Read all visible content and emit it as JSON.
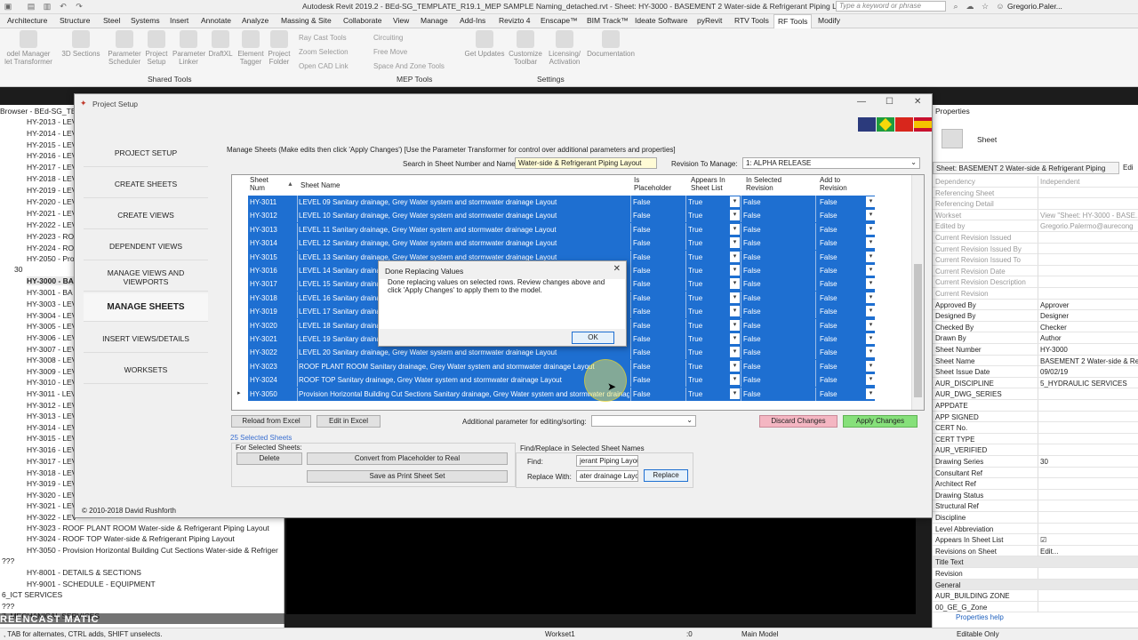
{
  "titlebar": {
    "title": "Autodesk Revit 2019.2 - BEd-SG_TEMPLATE_R19.1_MEP SAMPLE Naming_detached.rvt - Sheet: HY-3000 - BASEMENT 2 Water-side & Refrigerant Piping Layout",
    "search_placeholder": "Type a keyword or phrase",
    "user": "Gregorio.Paler..."
  },
  "ribbon_tabs": [
    "Architecture",
    "Structure",
    "Steel",
    "Systems",
    "Insert",
    "Annotate",
    "Analyze",
    "Massing & Site",
    "Collaborate",
    "View",
    "Manage",
    "Add-Ins",
    "Revizto 4",
    "Enscape™",
    "BIM Track™",
    "Ideate Software",
    "pyRevit",
    "RTV Tools",
    "RF Tools",
    "Modify"
  ],
  "ribbon": {
    "buttons": [
      "odel Manager\nlet Transformer",
      "3D Sections",
      "Parameter\nScheduler",
      "Project\nSetup",
      "Parameter\nLinker",
      "DraftXL",
      "Element\nTagger",
      "Project\nFolder",
      "Get Updates",
      "Customize\nToolbar",
      "Licensing/\nActivation",
      "Documentation"
    ],
    "small": [
      "Ray Cast Tools",
      "Zoom Selection",
      "Open CAD Link",
      "Circuiting",
      "Free Move",
      "Space And Zone Tools"
    ],
    "groups": [
      "Shared Tools",
      "MEP Tools",
      "Settings"
    ]
  },
  "browser": {
    "header": "Browser - BEd-SG_TEM",
    "items": [
      "HY-2013 - LEV",
      "HY-2014 - LEV",
      "HY-2015 - LEV",
      "HY-2016 - LEV",
      "HY-2017 - LEV",
      "HY-2018 - LEV",
      "HY-2019 - LEV",
      "HY-2020 - LEV",
      "HY-2021 - LEV",
      "HY-2022 - LEV",
      "HY-2023 - RO",
      "HY-2024 - RO",
      "HY-2050 - Pro",
      "30",
      "HY-3000 - BA",
      "HY-3001 - BA",
      "HY-3003 - LEV",
      "HY-3004 - LEV",
      "HY-3005 - LEV",
      "HY-3006 - LEV",
      "HY-3007 - LEV",
      "HY-3008 - LEV",
      "HY-3009 - LEV",
      "HY-3010 - LEV",
      "HY-3011 - LEV",
      "HY-3012 - LEV",
      "HY-3013 - LEV",
      "HY-3014 - LEV",
      "HY-3015 - LEV",
      "HY-3016 - LEV",
      "HY-3017 - LEV",
      "HY-3018 - LEV",
      "HY-3019 - LEV",
      "HY-3020 - LEV",
      "HY-3021 - LEV",
      "HY-3022 - LEV",
      "HY-3023 - ROOF PLANT ROOM Water-side & Refrigerant Piping Layout",
      "HY-3024 - ROOF TOP Water-side & Refrigerant Piping Layout",
      "HY-3050 - Provision Horizontal Building Cut Sections Water-side & Refriger",
      "???",
      "HY-8001 - DETAILS & SECTIONS",
      "HY-9001 - SCHEDULE - EQUIPMENT",
      "6_ICT SERVICES",
      "???",
      "7_MECHANICAL SERVICES"
    ]
  },
  "watermark": "REENCAST MATIC",
  "status_hint": ", TAB for alternates, CTRL adds, SHIFT unselects.",
  "status": {
    "workset": "Workset1",
    "zero": ":0",
    "model": "Main Model",
    "editable": "Editable Only"
  },
  "properties": {
    "header": "Properties",
    "type": "Sheet",
    "selector": "Sheet: BASEMENT 2 Water-side & Refrigerant Piping",
    "edit": "Edi",
    "rows": [
      {
        "k": "Dependency",
        "v": "Independent",
        "dim": true
      },
      {
        "k": "Referencing Sheet",
        "v": "",
        "dim": true
      },
      {
        "k": "Referencing Detail",
        "v": "",
        "dim": true
      },
      {
        "k": "Workset",
        "v": "View \"Sheet: HY-3000 - BASE...",
        "dim": true
      },
      {
        "k": "Edited by",
        "v": "Gregorio.Palermo@aurecong",
        "dim": true
      },
      {
        "k": "Current Revision Issued",
        "v": "",
        "dim": true
      },
      {
        "k": "Current Revision Issued By",
        "v": "",
        "dim": true
      },
      {
        "k": "Current Revision Issued To",
        "v": "",
        "dim": true
      },
      {
        "k": "Current Revision Date",
        "v": "",
        "dim": true
      },
      {
        "k": "Current Revision Description",
        "v": "",
        "dim": true
      },
      {
        "k": "Current Revision",
        "v": "",
        "dim": true
      },
      {
        "k": "Approved By",
        "v": "Approver",
        "dim": false
      },
      {
        "k": "Designed By",
        "v": "Designer",
        "dim": false
      },
      {
        "k": "Checked By",
        "v": "Checker",
        "dim": false
      },
      {
        "k": "Drawn By",
        "v": "Author",
        "dim": false
      },
      {
        "k": "Sheet Number",
        "v": "HY-3000",
        "dim": false
      },
      {
        "k": "Sheet Name",
        "v": "BASEMENT 2 Water-side & Re",
        "dim": false
      },
      {
        "k": "Sheet Issue Date",
        "v": "09/02/19",
        "dim": false
      },
      {
        "k": "AUR_DISCIPLINE",
        "v": "5_HYDRAULIC SERVICES",
        "dim": false
      },
      {
        "k": "AUR_DWG_SERIES",
        "v": "",
        "dim": false
      },
      {
        "k": "APPDATE",
        "v": "",
        "dim": false
      },
      {
        "k": "APP SIGNED",
        "v": "",
        "dim": false
      },
      {
        "k": "CERT No.",
        "v": "",
        "dim": false
      },
      {
        "k": "CERT TYPE",
        "v": "",
        "dim": false
      },
      {
        "k": "AUR_VERIFIED",
        "v": "",
        "dim": false
      },
      {
        "k": "Drawing Series",
        "v": "30",
        "dim": false
      },
      {
        "k": "Consultant Ref",
        "v": "",
        "dim": false
      },
      {
        "k": "Architect Ref",
        "v": "",
        "dim": false
      },
      {
        "k": "Drawing Status",
        "v": "",
        "dim": false
      },
      {
        "k": "Structural Ref",
        "v": "",
        "dim": false
      },
      {
        "k": "Discipline",
        "v": "",
        "dim": false
      },
      {
        "k": "Level Abbreviation",
        "v": "",
        "dim": false
      },
      {
        "k": "Appears In Sheet List",
        "v": "☑",
        "dim": false
      },
      {
        "k": "Revisions on Sheet",
        "v": "Edit...",
        "dim": false
      },
      {
        "k": "Title Text",
        "v": "",
        "dim": false,
        "section": true
      },
      {
        "k": "Revision",
        "v": "",
        "dim": false
      },
      {
        "k": "General",
        "v": "",
        "dim": false,
        "section": true
      },
      {
        "k": "AUR_BUILDING ZONE",
        "v": "",
        "dim": false
      },
      {
        "k": "00_GE_G_Zone",
        "v": "",
        "dim": false
      }
    ],
    "help": "Properties help"
  },
  "dialog": {
    "title": "Project Setup",
    "nav": [
      "PROJECT SETUP",
      "CREATE SHEETS",
      "CREATE VIEWS",
      "DEPENDENT VIEWS",
      "MANAGE VIEWS AND\nVIEWPORTS",
      "MANAGE SHEETS",
      "INSERT VIEWS/DETAILS",
      "WORKSETS"
    ],
    "copyright": "© 2010-2018 David Rushforth",
    "instructions": "Manage Sheets (Make edits then click 'Apply Changes') [Use the Parameter Transformer for control over additional parameters and properties]",
    "search_label": "Search in Sheet Number and Name:",
    "search_value": "Water-side & Refrigerant Piping Layout",
    "revision_label": "Revision To Manage:",
    "revision_value": "1: ALPHA RELEASE",
    "headers": [
      "Sheet\nNum",
      "Sheet Name",
      "Is\nPlaceholder",
      "Appears In\nSheet List",
      "In Selected\nRevision",
      "Add to\nRevision"
    ],
    "rows": [
      {
        "num": "HY-3011",
        "name": "LEVEL 09 Sanitary drainage, Grey Water system and stormwater drainage Layout",
        "ph": "False",
        "asl": "True",
        "isr": "False",
        "atr": "False"
      },
      {
        "num": "HY-3012",
        "name": "LEVEL 10 Sanitary drainage, Grey Water system and stormwater drainage Layout",
        "ph": "False",
        "asl": "True",
        "isr": "False",
        "atr": "False"
      },
      {
        "num": "HY-3013",
        "name": "LEVEL 11 Sanitary drainage, Grey Water system and stormwater drainage Layout",
        "ph": "False",
        "asl": "True",
        "isr": "False",
        "atr": "False"
      },
      {
        "num": "HY-3014",
        "name": "LEVEL 12 Sanitary drainage, Grey Water system and stormwater drainage Layout",
        "ph": "False",
        "asl": "True",
        "isr": "False",
        "atr": "False"
      },
      {
        "num": "HY-3015",
        "name": "LEVEL 13 Sanitary drainage, Grey Water system and stormwater drainage Layout",
        "ph": "False",
        "asl": "True",
        "isr": "False",
        "atr": "False"
      },
      {
        "num": "HY-3016",
        "name": "LEVEL 14 Sanitary drainage",
        "ph": "False",
        "asl": "True",
        "isr": "False",
        "atr": "False"
      },
      {
        "num": "HY-3017",
        "name": "LEVEL 15 Sanitary drainage",
        "ph": "False",
        "asl": "True",
        "isr": "False",
        "atr": "False"
      },
      {
        "num": "HY-3018",
        "name": "LEVEL 16 Sanitary drainage",
        "ph": "False",
        "asl": "True",
        "isr": "False",
        "atr": "False"
      },
      {
        "num": "HY-3019",
        "name": "LEVEL 17 Sanitary drainage",
        "ph": "False",
        "asl": "True",
        "isr": "False",
        "atr": "False"
      },
      {
        "num": "HY-3020",
        "name": "LEVEL 18 Sanitary drainage",
        "ph": "False",
        "asl": "True",
        "isr": "False",
        "atr": "False"
      },
      {
        "num": "HY-3021",
        "name": "LEVEL 19 Sanitary drainage",
        "ph": "False",
        "asl": "True",
        "isr": "False",
        "atr": "False"
      },
      {
        "num": "HY-3022",
        "name": "LEVEL 20 Sanitary drainage, Grey Water system and stormwater drainage Layout",
        "ph": "False",
        "asl": "True",
        "isr": "False",
        "atr": "False"
      },
      {
        "num": "HY-3023",
        "name": "ROOF PLANT ROOM Sanitary drainage, Grey Water system and stormwater drainage Layout",
        "ph": "False",
        "asl": "True",
        "isr": "False",
        "atr": "False"
      },
      {
        "num": "HY-3024",
        "name": "ROOF TOP Sanitary drainage, Grey Water system and stormwater drainage Layout",
        "ph": "False",
        "asl": "True",
        "isr": "False",
        "atr": "False"
      },
      {
        "num": "HY-3050",
        "name": "Provision Horizontal Building Cut Sections Sanitary drainage, Grey Water system and stormwater drainage Layout",
        "ph": "False",
        "asl": "True",
        "isr": "False",
        "atr": "False"
      }
    ],
    "reload": "Reload from Excel",
    "edit_excel": "Edit in Excel",
    "additional_param": "Additional parameter for editing/sorting:",
    "discard": "Discard Changes",
    "apply": "Apply Changes",
    "selected_count": "25 Selected Sheets",
    "for_selected": "For Selected Sheets:",
    "delete": "Delete",
    "convert": "Convert from Placeholder to Real",
    "save_print": "Save as Print Sheet Set",
    "find_replace_label": "Find/Replace in Selected Sheet Names",
    "find_label": "Find:",
    "find_value": "jerant Piping Layout",
    "replace_label": "Replace With:",
    "replace_value": "ater drainage Layout",
    "replace_btn": "Replace"
  },
  "message": {
    "title": "Done Replacing Values",
    "text": "Done replacing values on selected rows.  Review changes above and click 'Apply Changes' to apply them to the model.",
    "ok": "OK"
  },
  "colors": {
    "selection": "#1e6fd1",
    "discard": "#f4b6c2",
    "apply": "#86e07a"
  }
}
